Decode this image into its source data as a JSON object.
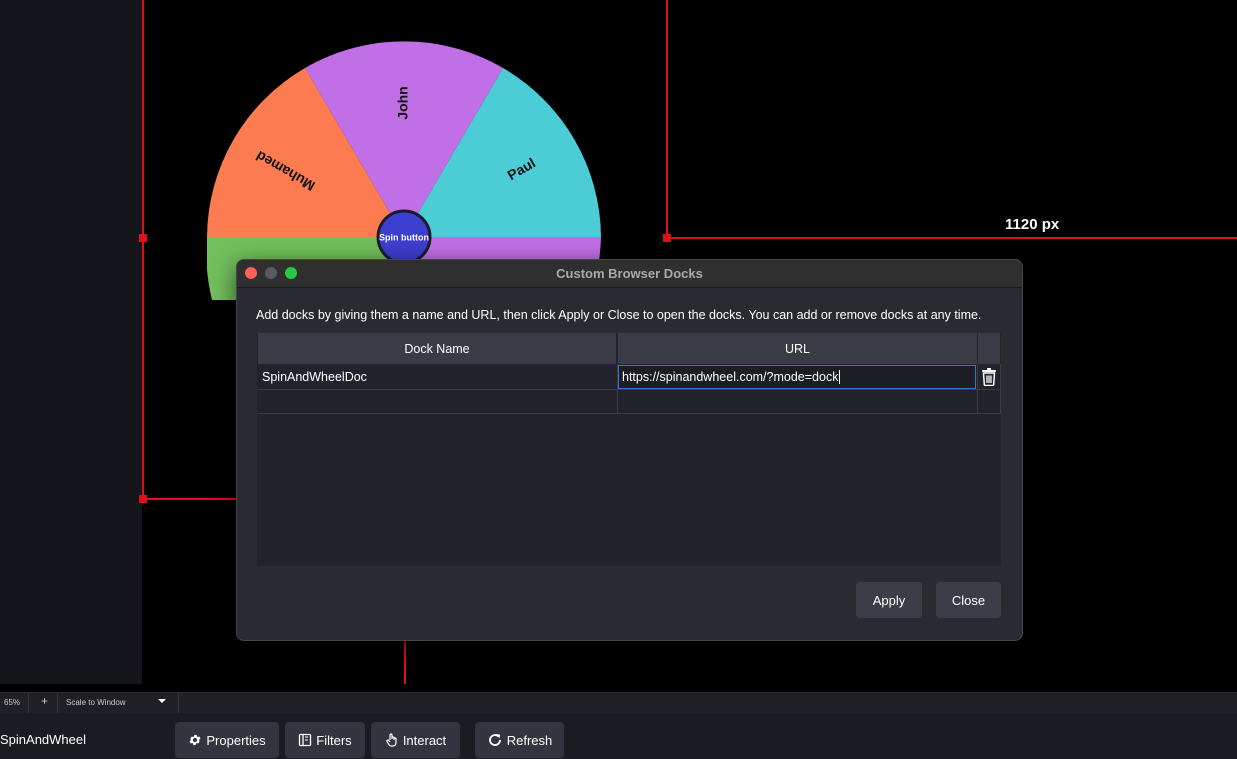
{
  "canvas": {
    "width_label": "1120 px",
    "wheel": {
      "segments": [
        "John",
        "Paul",
        "Muhamed"
      ],
      "spin_button_label": "Spin button",
      "colors": {
        "purple": "#c06fe6",
        "cyan": "#4ccdd5",
        "orange": "#fd7b51",
        "green": "#72bf5c",
        "spin_button": "#3d3fd0"
      }
    },
    "guide_color": "#e0101b"
  },
  "status_bar": {
    "zoom": "65%",
    "add_icon": "plus-icon",
    "scale_mode": "Scale to Window",
    "dropdown_icon": "chevron-down-icon"
  },
  "source_toolbar": {
    "source_name": "SpinAndWheel",
    "buttons": [
      {
        "label": "Properties",
        "icon": "gear-icon"
      },
      {
        "label": "Filters",
        "icon": "filter-icon"
      },
      {
        "label": "Interact",
        "icon": "hand-pointer-icon"
      },
      {
        "label": "Refresh",
        "icon": "refresh-icon"
      }
    ]
  },
  "dialog": {
    "title": "Custom Browser Docks",
    "description": "Add docks by giving them a name and URL, then click Apply or Close to open the docks. You can add or remove docks at any time.",
    "table": {
      "headers": [
        "Dock Name",
        "URL"
      ],
      "rows": [
        {
          "name": "SpinAndWheelDoc",
          "url": "https://spinandwheel.com/?mode=dock"
        },
        {
          "name": "",
          "url": ""
        }
      ]
    },
    "apply_label": "Apply",
    "close_label": "Close",
    "accent_color": "#3e6fd1"
  }
}
